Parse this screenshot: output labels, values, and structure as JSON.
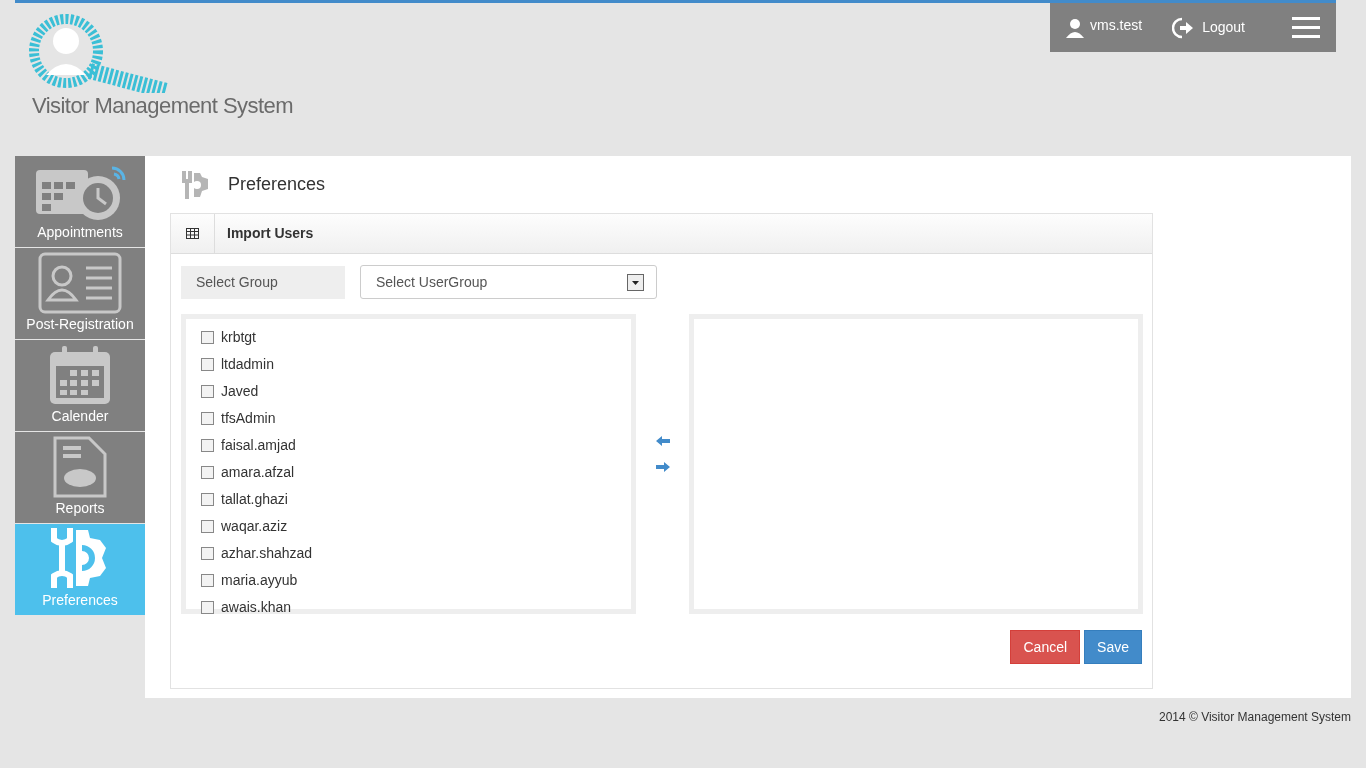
{
  "logo": {
    "text": "Visitor Management System"
  },
  "user_bar": {
    "username": "vms.test",
    "logout": "Logout"
  },
  "sidebar": {
    "items": [
      {
        "label": "Appointments",
        "kind": "calendar-clock",
        "selected": false
      },
      {
        "label": "Post-Registration",
        "kind": "id-card",
        "selected": false
      },
      {
        "label": "Calender",
        "kind": "calendar",
        "selected": false
      },
      {
        "label": "Reports",
        "kind": "report",
        "selected": false
      },
      {
        "label": "Preferences",
        "kind": "gear",
        "selected": true
      }
    ]
  },
  "page_title": "Preferences",
  "panel": {
    "title": "Import Users",
    "group_label": "Select Group",
    "group_select": {
      "value": "Select UserGroup"
    },
    "available_users": [
      {
        "name": "krbtgt",
        "checked": false
      },
      {
        "name": "ltdadmin",
        "checked": false
      },
      {
        "name": "Javed",
        "checked": false
      },
      {
        "name": "tfsAdmin",
        "checked": false
      },
      {
        "name": "faisal.amjad",
        "checked": false
      },
      {
        "name": "amara.afzal",
        "checked": false
      },
      {
        "name": "tallat.ghazi",
        "checked": false
      },
      {
        "name": "waqar.aziz",
        "checked": false
      },
      {
        "name": "azhar.shahzad",
        "checked": false
      },
      {
        "name": "maria.ayyub",
        "checked": false
      },
      {
        "name": "awais.khan",
        "checked": false
      }
    ],
    "buttons": [
      {
        "label": "Cancel",
        "kind": "cancel"
      },
      {
        "label": "Save",
        "kind": "save"
      }
    ]
  },
  "footer": "2014 © Visitor Management System"
}
